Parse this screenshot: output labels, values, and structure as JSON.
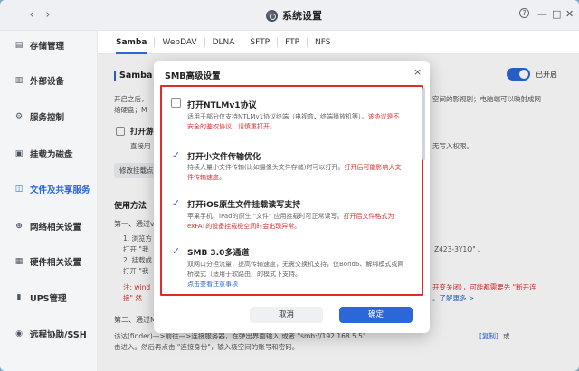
{
  "window": {
    "title": "系统设置",
    "back_icon": "‹",
    "forward_icon": "›",
    "help_icon": "?",
    "minimize_icon": "—",
    "maximize_icon": "□",
    "close_icon": "✕"
  },
  "sidebar": {
    "items": [
      {
        "label": "存储管理",
        "icon": "storage-icon",
        "glyph": "▤"
      },
      {
        "label": "外部设备",
        "icon": "device-icon",
        "glyph": "▥"
      },
      {
        "label": "服务控制",
        "icon": "service-icon",
        "glyph": "⚙"
      },
      {
        "label": "挂载为磁盘",
        "icon": "mount-icon",
        "glyph": "▣"
      },
      {
        "label": "文件及共享服务",
        "icon": "share-icon",
        "glyph": "◫"
      },
      {
        "label": "网络相关设置",
        "icon": "network-icon",
        "glyph": "⊕"
      },
      {
        "label": "硬件相关设置",
        "icon": "hardware-icon",
        "glyph": "▦"
      },
      {
        "label": "UPS管理",
        "icon": "ups-icon",
        "glyph": "▮"
      },
      {
        "label": "远程协助/SSH",
        "icon": "remote-icon",
        "glyph": "◉"
      }
    ],
    "active_index": 4
  },
  "tabs": [
    "Samba",
    "WebDAV",
    "DLNA",
    "SFTP",
    "FTP",
    "NFS"
  ],
  "background": {
    "section_title": "Samba",
    "toggle_label": "已开启",
    "intro_line1": "开启之后，",
    "intro_line1_right": "空间的影视剧；电脑端可以映射成网",
    "intro_line2": "络硬盘；M",
    "guest_label": "打开游",
    "guest_desc": "直接用",
    "guest_desc_right": "无写入权限。",
    "modify_btn": "修改挂载点",
    "usage_title": "使用方法",
    "step1": "第一、通过v",
    "step1_a": "1. 浏览方",
    "step1_b": "打开 \"我",
    "step1_b_right": "Z423-3Y1Q\" 。",
    "step1_c": "2. 挂载成",
    "step1_d": "打开 \"我",
    "note_red": "注: wind",
    "note_red_right": "开变关闭），可能都需要先 \"断开连",
    "note_red2": "接\" 然",
    "note_red2_right": "。了解更多 >",
    "step2": "第二、通过M",
    "step2_a": "访达(finder)—>前往—>连接服务器，在弹出界面输入 或者 \"smb://192.168.5.5\"",
    "step2_copy": "[复制]",
    "step2_a_tail": "或",
    "step2_b": "击进入。然后再点击 \"连接身份\"，输入极空间的账号和密码。"
  },
  "modal": {
    "title": "SMB高级设置",
    "close_icon": "×",
    "options": [
      {
        "checked": false,
        "title": "打开NTLMv1协议",
        "desc": "适用于部分仅支持NTLMv1协议终端（电视盒、终端播放机等）。",
        "desc_red": "该协议是不安全的鉴权协议，请慎重打开。",
        "link": ""
      },
      {
        "checked": true,
        "title": "打开小文件传输优化",
        "desc": "持续大量小文件传输(比如摄像头文件存储)时可以打开。",
        "desc_red": "打开后可能影响大文件传输速度。",
        "link": ""
      },
      {
        "checked": true,
        "title": "打开iOS原生文件挂载读写支持",
        "desc": "苹果手机、iPad的原生 \"文件\" 应用挂载时可正常读写。",
        "desc_red": "打开后文件格式为exFAT的设备挂载极空间时会出现异常。",
        "link": ""
      },
      {
        "checked": true,
        "title": "SMB 3.0多通道",
        "desc": "双网口分担流量，提高传输速度，无需交换机支持，仅Bond6、解绑模式或网桥模式（适用于软路由）的模式下支持。",
        "desc_red": "",
        "link": "点击查看注意事项"
      }
    ],
    "cancel_label": "取消",
    "ok_label": "确定"
  },
  "colors": {
    "accent": "#2a67d8",
    "warning_red": "#d62f2f",
    "highlight_border": "#e02b2b"
  }
}
